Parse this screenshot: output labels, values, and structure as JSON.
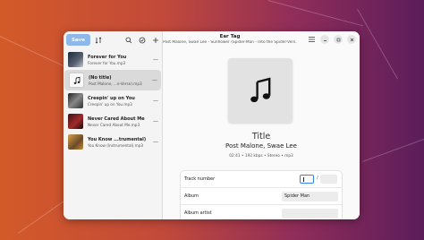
{
  "window": {
    "title": "Ear Tag",
    "subtitle": "Post Malone, Swae Lee - Sunflower (Spider-Man - Into the Spider-Vers..."
  },
  "sidebar": {
    "save_label": "Save",
    "items": [
      {
        "title": "Forever for You",
        "file": "Forever for You.mp3",
        "cover": "album-art-1"
      },
      {
        "title": "(No title)",
        "file": "Post Malone, ...e-Verse).mp3",
        "cover": "music-note-icon"
      },
      {
        "title": "Creepin' up on You",
        "file": "Creepin' up on You.mp3",
        "cover": "album-art-3"
      },
      {
        "title": "Never Cared About Me",
        "file": "Never Cared About Me.mp3",
        "cover": "album-art-4"
      },
      {
        "title": "You Know ...trumental)",
        "file": "You Know (Instrumental).mp3",
        "cover": "album-art-5"
      }
    ],
    "item_action": "—"
  },
  "details": {
    "title": "Title",
    "artist": "Post Malone, Swae Lee",
    "info": "02:41 • 192 kbps • Stereo • mp3"
  },
  "form": {
    "track_label": "Track number",
    "track_value": "",
    "track_separator": "/",
    "track_total": "",
    "album_label": "Album",
    "album_value": "Spider Man",
    "album_artist_label": "Album artist",
    "album_artist_value": ""
  },
  "colors": {
    "accent": "#3584e4",
    "save_button": "#8fb8ea"
  }
}
